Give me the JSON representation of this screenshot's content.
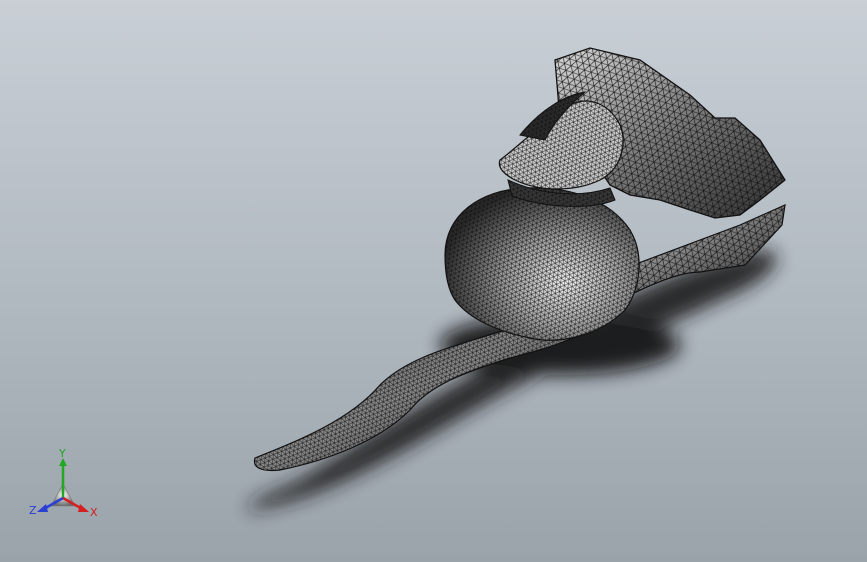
{
  "viewport": {
    "background_top": "#c9cfd5",
    "background_bottom": "#9aa2aa"
  },
  "model": {
    "display_mode": "mesh",
    "mesh_color": "#1a1a1a",
    "surface_light": "#ededed",
    "surface_dark": "#3a3a3a"
  },
  "triad": {
    "x_label": "X",
    "y_label": "Y",
    "z_label": "Z",
    "x_color": "#d42020",
    "y_color": "#22a822",
    "z_color": "#2a3fd6"
  }
}
